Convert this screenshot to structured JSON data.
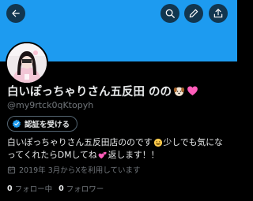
{
  "colors": {
    "banner": "#1d9bf0",
    "background": "#000000",
    "text_primary": "#e7e9ea",
    "text_secondary": "#71767b",
    "verify_badge": "#1d9bf0",
    "heart": "#ff5dba"
  },
  "header": {
    "icons": [
      "back-arrow-icon",
      "search-icon",
      "pencil-icon",
      "share-icon"
    ]
  },
  "profile": {
    "display_name": "白いぽっちゃりさん五反田 のの",
    "name_emojis": [
      "dog-face-emoji",
      "pink-heart-emoji"
    ],
    "handle": "@my9rtck0qKtopyh",
    "verify_label": "認証を受ける",
    "bio_line1": "白いぽっちゃりさん五反田店ののです",
    "bio_line1_after": "少しでも気にな",
    "bio_line2": "ってくれたらDMしてね",
    "bio_line2_after": "返します！！",
    "bio_emojis": [
      "grinning-face-emoji",
      "two-hearts-emoji"
    ],
    "joined": "2019年 3月からXを利用しています",
    "following_count": "0",
    "following_label": "フォロー中",
    "followers_count": "0",
    "followers_label": "フォロワー"
  }
}
